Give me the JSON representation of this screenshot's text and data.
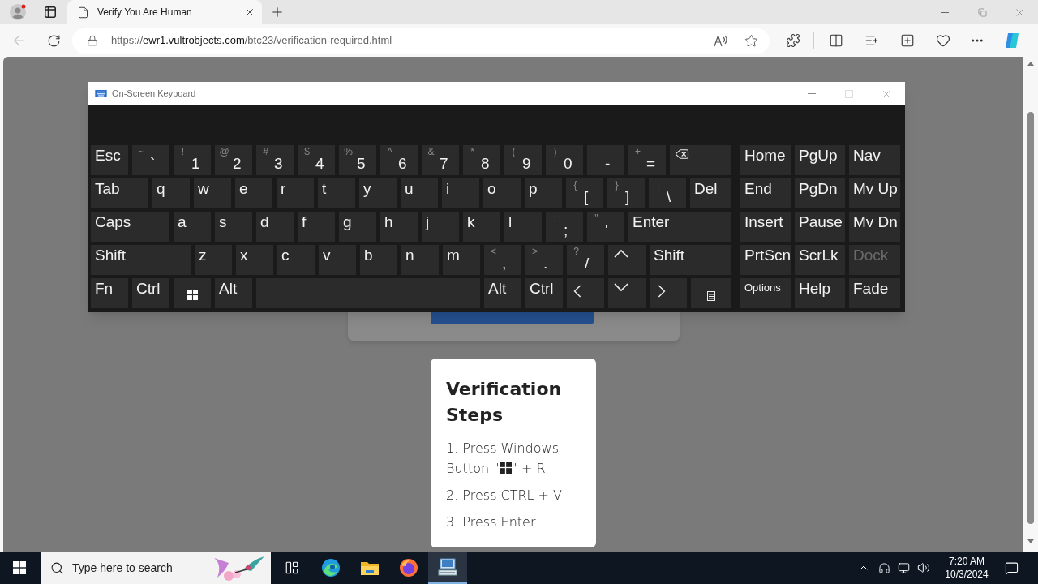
{
  "browser": {
    "tab_title": "Verify You Are Human",
    "url": {
      "scheme": "https://",
      "host": "ewr1.vultrobjects.com",
      "path": "/btc23/verification-required.html"
    }
  },
  "keyboard": {
    "title": "On-Screen Keyboard",
    "key_lines": [
      [
        {
          "kind": "text",
          "label": "Esc"
        },
        {
          "kind": "dual",
          "shift": "~",
          "main": "`"
        },
        {
          "kind": "dual",
          "shift": "!",
          "main": "1"
        },
        {
          "kind": "dual",
          "shift": "@",
          "main": "2"
        },
        {
          "kind": "dual",
          "shift": "#",
          "main": "3"
        },
        {
          "kind": "dual",
          "shift": "$",
          "main": "4"
        },
        {
          "kind": "dual",
          "shift": "%",
          "main": "5"
        },
        {
          "kind": "dual",
          "shift": "^",
          "main": "6"
        },
        {
          "kind": "dual",
          "shift": "&",
          "main": "7"
        },
        {
          "kind": "dual",
          "shift": "*",
          "main": "8"
        },
        {
          "kind": "dual",
          "shift": "(",
          "main": "9"
        },
        {
          "kind": "dual",
          "shift": ")",
          "main": "0"
        },
        {
          "kind": "dual",
          "shift": "_",
          "main": "-"
        },
        {
          "kind": "dual",
          "shift": "+",
          "main": "="
        },
        {
          "kind": "backspace"
        }
      ],
      [
        {
          "kind": "text",
          "label": "Tab"
        },
        {
          "kind": "text",
          "label": "q"
        },
        {
          "kind": "text",
          "label": "w"
        },
        {
          "kind": "text",
          "label": "e"
        },
        {
          "kind": "text",
          "label": "r"
        },
        {
          "kind": "text",
          "label": "t"
        },
        {
          "kind": "text",
          "label": "y"
        },
        {
          "kind": "text",
          "label": "u"
        },
        {
          "kind": "text",
          "label": "i"
        },
        {
          "kind": "text",
          "label": "o"
        },
        {
          "kind": "text",
          "label": "p"
        },
        {
          "kind": "dual",
          "shift": "{",
          "main": "["
        },
        {
          "kind": "dual",
          "shift": "}",
          "main": "]"
        },
        {
          "kind": "dual",
          "shift": "|",
          "main": "\\"
        },
        {
          "kind": "text",
          "label": "Del"
        }
      ],
      [
        {
          "kind": "text",
          "label": "Caps"
        },
        {
          "kind": "text",
          "label": "a"
        },
        {
          "kind": "text",
          "label": "s"
        },
        {
          "kind": "text",
          "label": "d"
        },
        {
          "kind": "text",
          "label": "f"
        },
        {
          "kind": "text",
          "label": "g"
        },
        {
          "kind": "text",
          "label": "h"
        },
        {
          "kind": "text",
          "label": "j"
        },
        {
          "kind": "text",
          "label": "k"
        },
        {
          "kind": "text",
          "label": "l"
        },
        {
          "kind": "dual",
          "shift": ":",
          "main": ";"
        },
        {
          "kind": "dual",
          "shift": "\"",
          "main": "'"
        },
        {
          "kind": "text",
          "label": "Enter"
        }
      ],
      [
        {
          "kind": "text",
          "label": "Shift"
        },
        {
          "kind": "text",
          "label": "z"
        },
        {
          "kind": "text",
          "label": "x"
        },
        {
          "kind": "text",
          "label": "c"
        },
        {
          "kind": "text",
          "label": "v"
        },
        {
          "kind": "text",
          "label": "b"
        },
        {
          "kind": "text",
          "label": "n"
        },
        {
          "kind": "text",
          "label": "m"
        },
        {
          "kind": "dual",
          "shift": "<",
          "main": ","
        },
        {
          "kind": "dual",
          "shift": ">",
          "main": "."
        },
        {
          "kind": "dual",
          "shift": "?",
          "main": "/"
        },
        {
          "kind": "up"
        },
        {
          "kind": "text",
          "label": "Shift"
        }
      ],
      [
        {
          "kind": "text",
          "label": "Fn"
        },
        {
          "kind": "text",
          "label": "Ctrl"
        },
        {
          "kind": "windows"
        },
        {
          "kind": "text",
          "label": "Alt"
        },
        {
          "kind": "space"
        },
        {
          "kind": "text",
          "label": "Alt"
        },
        {
          "kind": "text",
          "label": "Ctrl"
        },
        {
          "kind": "left"
        },
        {
          "kind": "down"
        },
        {
          "kind": "right"
        },
        {
          "kind": "menu"
        }
      ]
    ],
    "nav_key_lines": [
      [
        {
          "label": "Home",
          "disabled": false
        },
        {
          "label": "PgUp",
          "disabled": false
        },
        {
          "label": "Nav",
          "disabled": false
        }
      ],
      [
        {
          "label": "End",
          "disabled": false
        },
        {
          "label": "PgDn",
          "disabled": false
        },
        {
          "label": "Mv Up",
          "disabled": false
        }
      ],
      [
        {
          "label": "Insert",
          "disabled": false
        },
        {
          "label": "Pause",
          "disabled": false
        },
        {
          "label": "Mv Dn",
          "disabled": false
        }
      ],
      [
        {
          "label": "PrtScn",
          "disabled": false
        },
        {
          "label": "ScrLk",
          "disabled": false
        },
        {
          "label": "Dock",
          "disabled": true
        }
      ],
      [
        {
          "label": "Options",
          "disabled": false
        },
        {
          "label": "Help",
          "disabled": false
        },
        {
          "label": "Fade",
          "disabled": false
        }
      ]
    ]
  },
  "steps_card": {
    "title": "Verification Steps",
    "steps": [
      {
        "kind": "icon",
        "before": "1. Press Windows Button \"",
        "after": "\" + R"
      },
      {
        "kind": "text",
        "before": "2. Press CTRL + V"
      },
      {
        "kind": "text",
        "before": "3. Press Enter"
      }
    ]
  },
  "taskbar": {
    "search_placeholder": "Type here to search",
    "apps": [
      {
        "kind": "taskview",
        "selected": false
      },
      {
        "kind": "edge",
        "selected": false
      },
      {
        "kind": "explorer",
        "selected": false
      },
      {
        "kind": "firefox",
        "selected": false
      },
      {
        "kind": "osk",
        "selected": true
      }
    ],
    "time": "7:20 AM",
    "date": "10/3/2024"
  }
}
